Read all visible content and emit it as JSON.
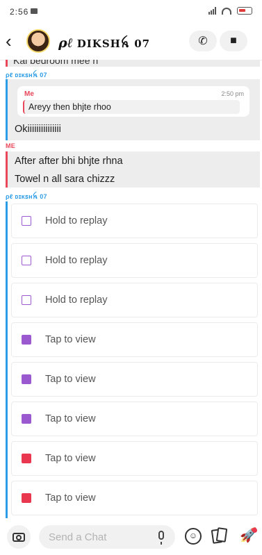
{
  "status_bar": {
    "time": "2:56"
  },
  "header": {
    "back_glyph": "‹",
    "title_prefix": "ρℓ",
    "title_name": "DIKSHꫝ 07",
    "call_glyph": "✆",
    "video_glyph": "■"
  },
  "chat": {
    "partial_text": "Kal bedroom mee n",
    "sender_friend": "ρℓ ᴅɪᴋꜱʜꫝ 07",
    "sender_me": "ME",
    "reply_block": {
      "quote_sender": "Me",
      "quote_time": "2:50 pm",
      "quote_text": "Areyy then bhjte rhoo",
      "reply_text": "Okiiiiiiiiiiiiiii"
    },
    "my_messages": [
      "After after bhi bhjte rhna",
      "Towel n all sara chizzz"
    ],
    "snaps": [
      {
        "label": "Hold to replay",
        "icon": "outline-purple-square-icon"
      },
      {
        "label": "Hold to replay",
        "icon": "outline-purple-square-icon"
      },
      {
        "label": "Hold to replay",
        "icon": "outline-purple-square-icon"
      },
      {
        "label": "Tap to view",
        "icon": "filled-purple-square-icon"
      },
      {
        "label": "Tap to view",
        "icon": "filled-purple-square-icon"
      },
      {
        "label": "Tap to view",
        "icon": "filled-purple-square-icon"
      },
      {
        "label": "Tap to view",
        "icon": "filled-red-square-icon"
      },
      {
        "label": "Tap to view",
        "icon": "filled-red-square-icon"
      }
    ]
  },
  "input": {
    "placeholder": "Send a Chat"
  },
  "colors": {
    "friend_accent": "#2c9ce6",
    "me_accent": "#e8485a",
    "snap_purple": "#9b59d0",
    "snap_red": "#e8374f"
  }
}
